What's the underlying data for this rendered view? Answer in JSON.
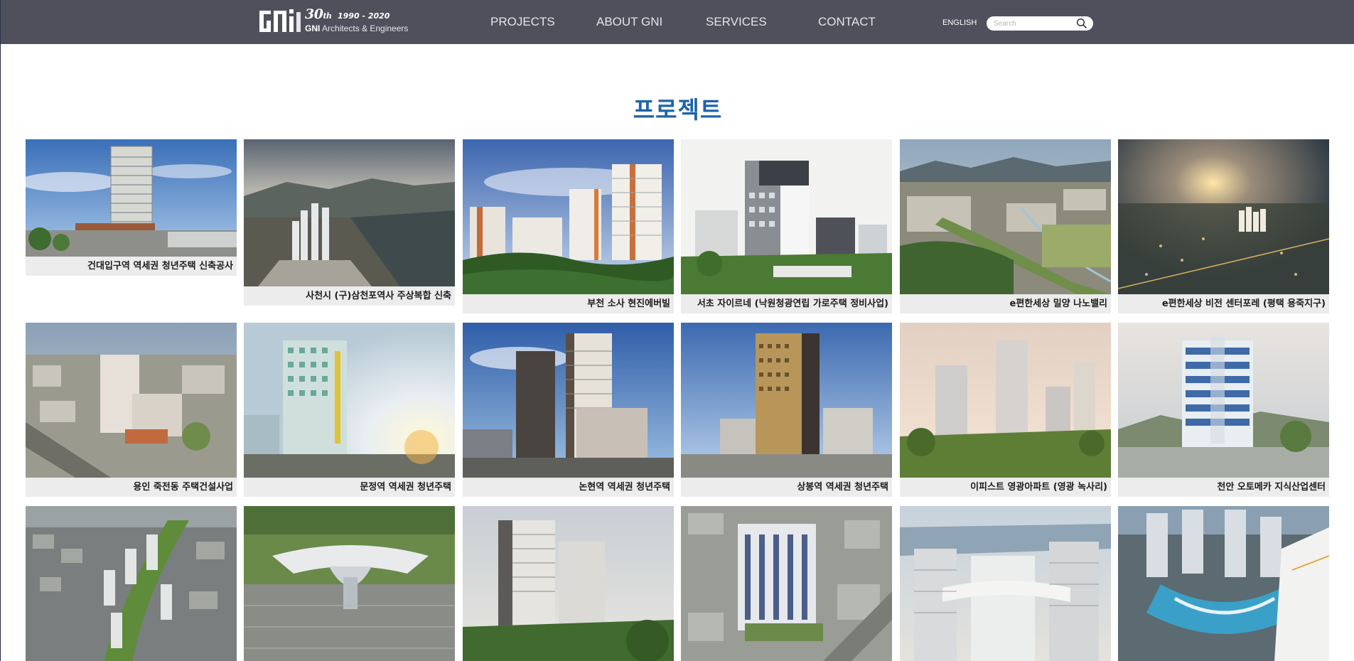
{
  "header": {
    "logo_years": "1990 - 2020",
    "logo_30": "30",
    "logo_th": "th",
    "logo_brand": "GNI",
    "logo_tagline": "Architects & Engineers",
    "nav": [
      "PROJECTS",
      "ABOUT GNI",
      "SERVICES",
      "CONTACT"
    ],
    "lang": "ENGLISH",
    "search_placeholder": "Search"
  },
  "page_title": "프로젝트",
  "projects": [
    {
      "caption": "건대입구역 역세권 청년주택 신축공사",
      "scene": "tower-day"
    },
    {
      "caption": "사천시 (구)삼천포역사 주상복합 신축",
      "scene": "harbor-dusk"
    },
    {
      "caption": "부천 소사 현진에버빌",
      "scene": "apartments-forest"
    },
    {
      "caption": "서초 자이르네 (낙원청광연립 가로주택 정비사업)",
      "scene": "midrise-green"
    },
    {
      "caption": "e편한세상 밀양 나노밸리",
      "scene": "aerial-valley"
    },
    {
      "caption": "e편한세상 비전 센터포레 (평택 용죽지구)",
      "scene": "aerial-night"
    },
    {
      "caption": "용인 죽전동 주택건설사업",
      "scene": "aerial-street"
    },
    {
      "caption": "문정역 역세권 청년주택",
      "scene": "tower-sunset"
    },
    {
      "caption": "논현역 역세권 청년주택",
      "scene": "twin-towers"
    },
    {
      "caption": "상봉역 역세권 청년주택",
      "scene": "brown-tower"
    },
    {
      "caption": "이피스트 영광아파트 (영광 녹사리)",
      "scene": "apartments-sunset"
    },
    {
      "caption": "천안 오토메카 지식산업센터",
      "scene": "glass-tower"
    },
    {
      "caption": "",
      "scene": "aerial-complex"
    },
    {
      "caption": "",
      "scene": "terminal"
    },
    {
      "caption": "",
      "scene": "apartment-river"
    },
    {
      "caption": "",
      "scene": "midrise-aerial"
    },
    {
      "caption": "",
      "scene": "river-towers"
    },
    {
      "caption": "",
      "scene": "pool-towers"
    }
  ],
  "icons": {
    "search": "search-icon",
    "logo": "gni-logo-mark"
  },
  "colors": {
    "header_bg": "#50505c",
    "title": "#1f64a8",
    "caption_bg": "#ececec"
  }
}
